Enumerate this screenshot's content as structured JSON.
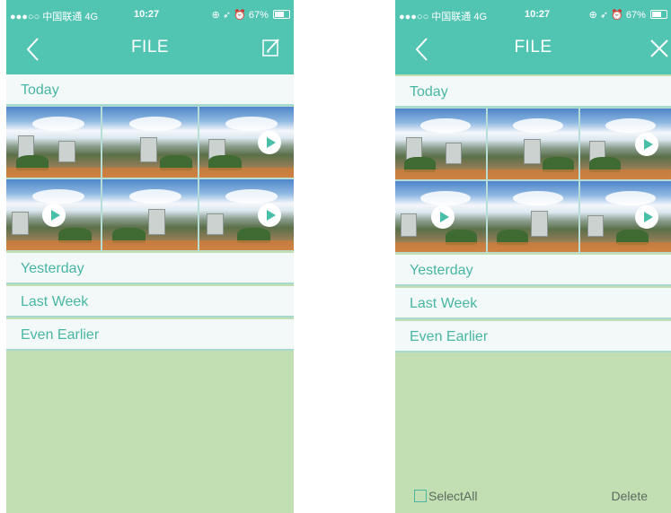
{
  "status_bar": {
    "carrier": "●●●○○ 中国联通  4G",
    "time": "10:27",
    "right": "⊕ ➶ ⏰ 67%"
  },
  "left_screen": {
    "title": "FILE",
    "sections": [
      "Today",
      "Yesterday",
      "Last Week",
      "Even Earlier"
    ]
  },
  "right_screen": {
    "title": "FILE",
    "sections": [
      "Today",
      "Yesterday",
      "Last Week",
      "Even Earlier"
    ],
    "select_all_label": "SelectAll",
    "delete_label": "Delete"
  },
  "colors": {
    "header": "#52c4b2",
    "section_text": "#48b6a4",
    "background": "#c1dfb2"
  },
  "icons": [
    "back-arrow-icon",
    "edit-icon",
    "close-icon",
    "play-icon",
    "checkbox-icon"
  ]
}
